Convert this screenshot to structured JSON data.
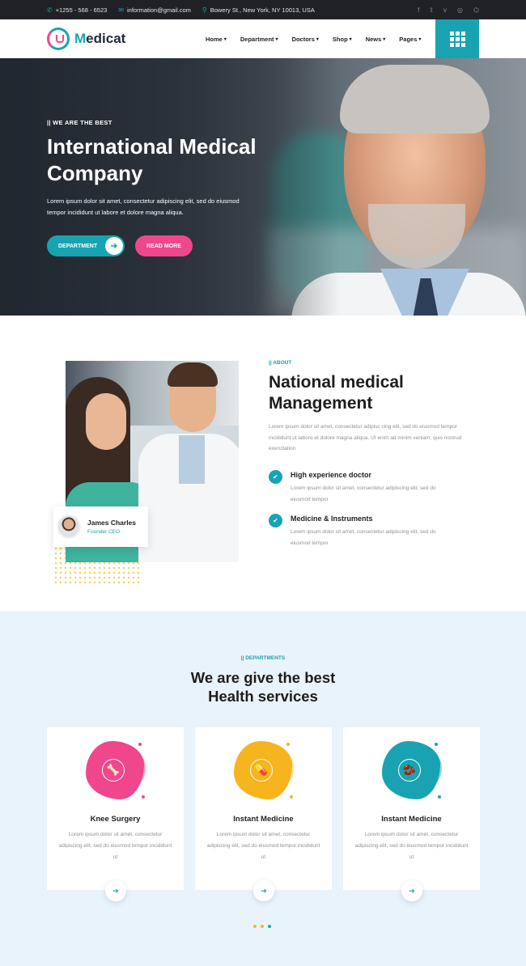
{
  "topbar": {
    "phone": "+1255 - 568 - 6523",
    "email": "information@gmail.com",
    "address": "Bowery St., New York, NY 10013, USA",
    "social": [
      "f",
      "𝕥",
      "v",
      "◎",
      "⌬"
    ]
  },
  "nav": {
    "logo_m": "M",
    "logo_rest": "edicat",
    "items": [
      "Home",
      "Department",
      "Doctors",
      "Shop",
      "News",
      "Pages"
    ]
  },
  "hero": {
    "tag": "|| WE ARE THE BEST",
    "title": "International Medical Company",
    "desc": "Lorem ipsum dolor sit amet, consectetur adipiscing elit, sed do eiusmod tempor incididunt ut labore et dolore magna aliqua.",
    "btn_department": "DEPARTMENT",
    "btn_read_more": "READ MORE"
  },
  "about": {
    "label": "|| ABOUT",
    "title": "National medical Management",
    "para": "Lorem ipsum dolor sit amet, consectetur adipisc cing elit, sed do eiusmod tempor incididunt ut labore et dolore magna aliqua. Ut enim ad minim veniam, quis nostrud exercitation",
    "badge_name": "James Charles",
    "badge_role": "Founder CEO",
    "features": [
      {
        "title": "High experience doctor",
        "desc": "Lorem ipsum dolor sit amet, consectetur adipiscing elit, sed do eiusmod tempor"
      },
      {
        "title": "Medicine & Instruments",
        "desc": "Lorem ipsum dolor sit amet, consectetur adipiscing elit, sed do eiusmod tempor"
      }
    ]
  },
  "departments": {
    "label": "|| DEPARTMENTS",
    "title_line1": "We are give the best",
    "title_line2": "Health services",
    "cards": [
      {
        "title": "Knee Surgery",
        "desc": "Lorem ipsum dolor sit amet, consectetur adipiscing elit, sed do eiusmod tempor incididunt ut",
        "color": "#f0478c",
        "icon": "🦴"
      },
      {
        "title": "Instant Medicine",
        "desc": "Lorem ipsum dolor sit amet, consectetur adipiscing elit, sed do eiusmod tempor incididunt ut",
        "color": "#f6b51e",
        "icon": "💊"
      },
      {
        "title": "Instant Medicine",
        "desc": "Lorem ipsum dolor sit amet, consectetur adipiscing elit, sed do eiusmod tempor incididunt ut",
        "color": "#19a3b2",
        "icon": "🫘"
      }
    ]
  },
  "colors": {
    "accent": "#19a3b2",
    "pink": "#f0478c",
    "yellow": "#f6b51e",
    "dark": "#1f2125"
  }
}
